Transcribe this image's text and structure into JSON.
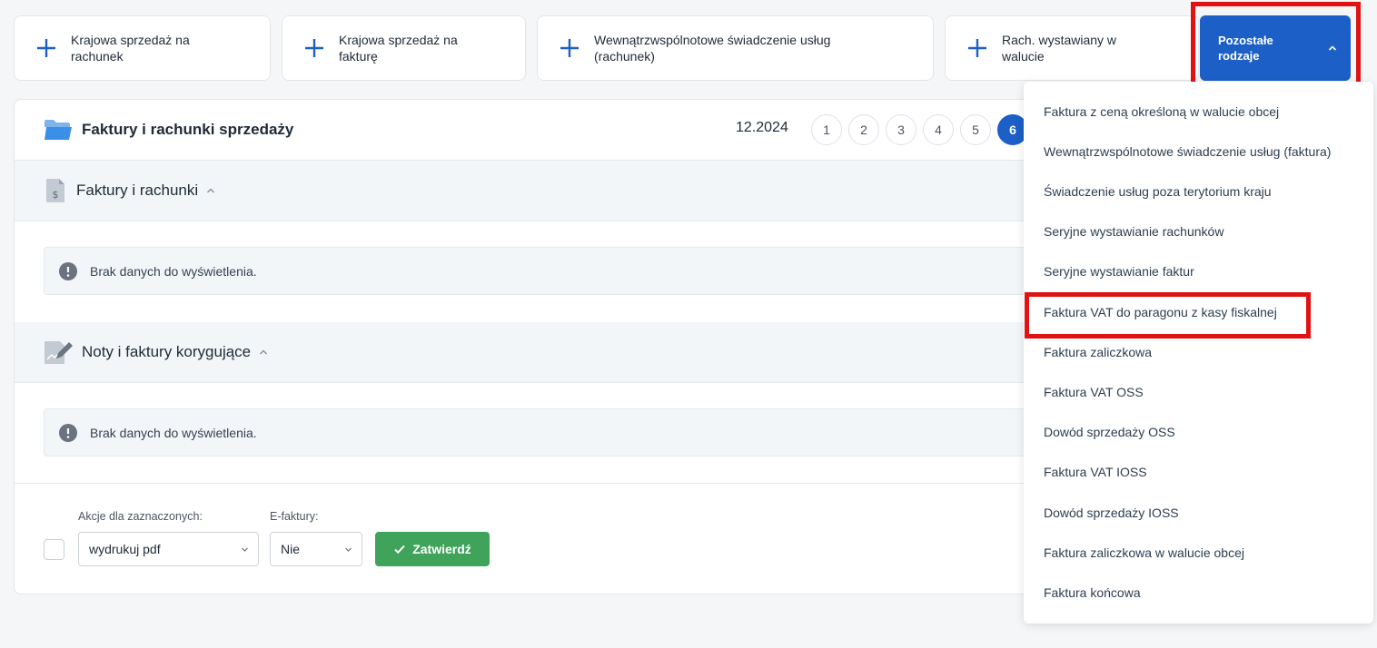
{
  "quick_actions": [
    {
      "line1": "Krajowa sprzedaż na",
      "line2": "rachunek"
    },
    {
      "line1": "Krajowa sprzedaż na",
      "line2": "fakturę"
    },
    {
      "line1": "Wewnątrzwspólnotowe  świadczenie usług",
      "line2": "(rachunek)"
    },
    {
      "line1": "Rach. wystawiany w",
      "line2": "walucie"
    }
  ],
  "other_types": {
    "line1": "Pozostałe",
    "line2": "rodzaje"
  },
  "panel": {
    "title": "Faktury i rachunki sprzedaży",
    "period": "12.2024",
    "pages": [
      "1",
      "2",
      "3",
      "4",
      "5",
      "6"
    ],
    "active_page": "6"
  },
  "sections": [
    {
      "title": "Faktury i rachunki",
      "message": "Brak danych do wyświetlenia."
    },
    {
      "title": "Noty i faktury korygujące",
      "message": "Brak danych do wyświetlenia."
    }
  ],
  "footer": {
    "actions_label": "Akcje dla zaznaczonych:",
    "actions_value": "wydrukuj pdf",
    "efaktury_label": "E-faktury:",
    "efaktury_value": "Nie",
    "confirm_label": "Zatwierdź"
  },
  "dropdown_items": [
    "Faktura z ceną określoną w walucie obcej",
    "Wewnątrzwspólnotowe świadczenie usług (faktura)",
    "Świadczenie usług poza terytorium kraju",
    "Seryjne wystawianie rachunków",
    "Seryjne wystawianie faktur",
    "Faktura VAT do paragonu z kasy fiskalnej",
    "Faktura zaliczkowa",
    "Faktura VAT OSS",
    "Dowód sprzedaży OSS",
    "Faktura VAT IOSS",
    "Dowód sprzedaży IOSS",
    "Faktura zaliczkowa w walucie obcej",
    "Faktura końcowa"
  ],
  "colors": {
    "primary": "#1c5fc7",
    "success": "#3fa35a",
    "highlight": "#e01212"
  }
}
